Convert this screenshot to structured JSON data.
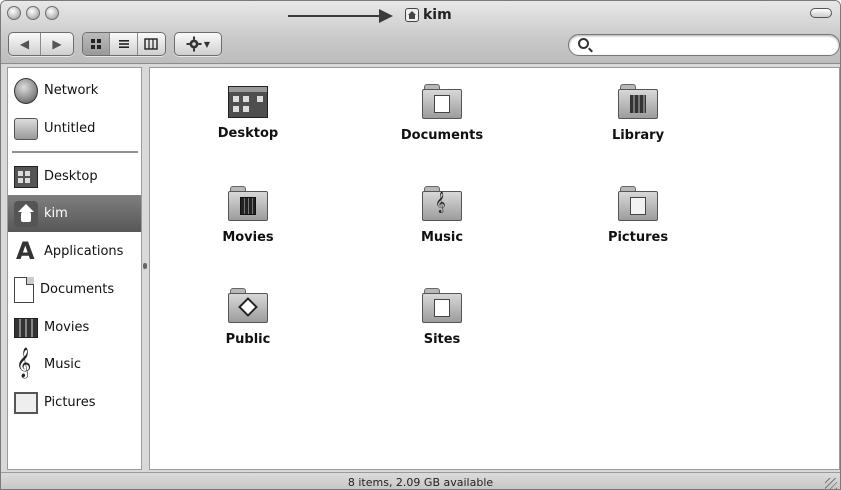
{
  "window": {
    "title": "kim",
    "title_icon": "home-icon"
  },
  "toolbar": {
    "back_icon": "◀",
    "forward_icon": "▶",
    "view_icons": [
      "icon-view-icon",
      "list-view-icon",
      "column-view-icon"
    ],
    "action_icon": "gear-icon",
    "search_placeholder": ""
  },
  "sidebar": {
    "devices": [
      {
        "label": "Network",
        "icon": "network-globe-icon"
      },
      {
        "label": "Untitled",
        "icon": "hard-disk-icon"
      }
    ],
    "places": [
      {
        "label": "Desktop",
        "icon": "desktop-icon"
      },
      {
        "label": "kim",
        "icon": "home-icon",
        "selected": true
      },
      {
        "label": "Applications",
        "icon": "applications-icon"
      },
      {
        "label": "Documents",
        "icon": "document-icon"
      },
      {
        "label": "Movies",
        "icon": "film-icon"
      },
      {
        "label": "Music",
        "icon": "music-note-icon"
      },
      {
        "label": "Pictures",
        "icon": "picture-frame-icon"
      }
    ]
  },
  "content": {
    "items": [
      {
        "label": "Desktop",
        "icon": "desktop-folder-icon"
      },
      {
        "label": "Documents",
        "icon": "documents-folder-icon"
      },
      {
        "label": "Library",
        "icon": "library-folder-icon"
      },
      {
        "label": "Movies",
        "icon": "movies-folder-icon"
      },
      {
        "label": "Music",
        "icon": "music-folder-icon"
      },
      {
        "label": "Pictures",
        "icon": "pictures-folder-icon"
      },
      {
        "label": "Public",
        "icon": "public-folder-icon"
      },
      {
        "label": "Sites",
        "icon": "sites-folder-icon"
      }
    ]
  },
  "statusbar": {
    "text": "8 items, 2.09 GB available"
  }
}
